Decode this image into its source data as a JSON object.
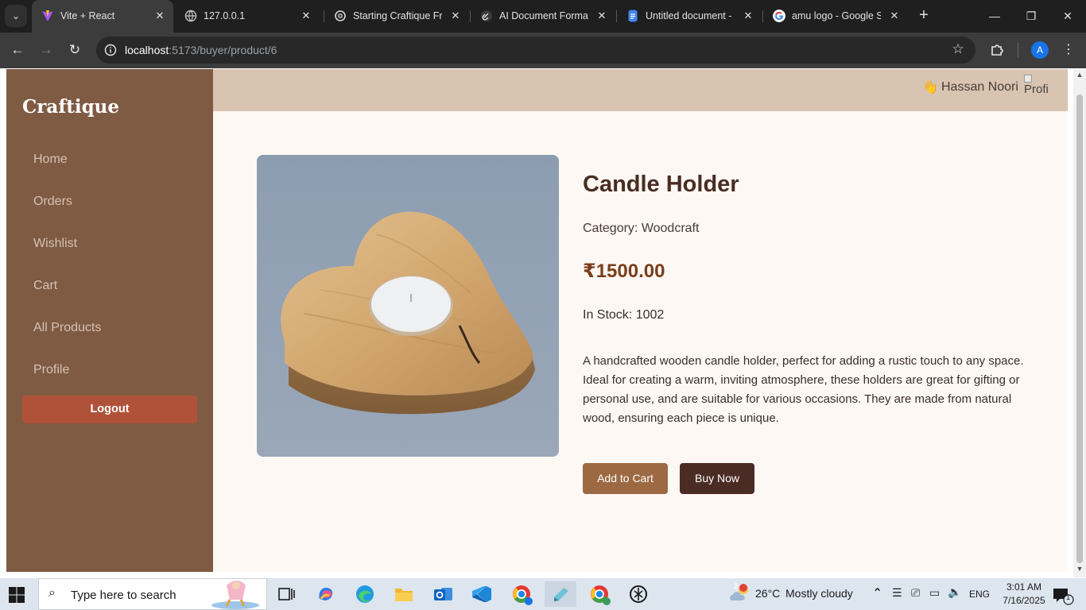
{
  "browser": {
    "tabs": [
      {
        "title": "Vite + React",
        "active": true,
        "icon": "vite-icon"
      },
      {
        "title": "127.0.0.1",
        "active": false,
        "icon": "globe-icon"
      },
      {
        "title": "Starting Craftique Fre",
        "active": false,
        "icon": "chatgpt-icon"
      },
      {
        "title": "AI Document Formatt",
        "active": false,
        "icon": "link-icon"
      },
      {
        "title": "Untitled document - ",
        "active": false,
        "icon": "docs-icon"
      },
      {
        "title": "amu logo - Google Se",
        "active": false,
        "icon": "google-icon"
      }
    ],
    "address": {
      "host": "localhost",
      "path": ":5173/buyer/product/6"
    },
    "profile_initial": "A"
  },
  "sidebar": {
    "brand": "Craftique",
    "items": [
      {
        "label": "Home"
      },
      {
        "label": "Orders"
      },
      {
        "label": "Wishlist"
      },
      {
        "label": "Cart"
      },
      {
        "label": "All Products"
      },
      {
        "label": "Profile"
      }
    ],
    "logout_label": "Logout"
  },
  "topbar": {
    "wave_emoji": "👋",
    "username": "Hassan Noori",
    "profile_alt": "Profi"
  },
  "product": {
    "title": "Candle Holder",
    "category": "Category: Woodcraft",
    "price": "₹1500.00",
    "stock": "In Stock: 1002",
    "description": "A handcrafted wooden candle holder, perfect for adding a rustic touch to any space. Ideal for creating a warm, inviting atmosphere, these holders are great for gifting or personal use, and are suitable for various occasions. They are made from natural wood, ensuring each piece is unique.",
    "add_to_cart_label": "Add to Cart",
    "buy_now_label": "Buy Now"
  },
  "taskbar": {
    "search_placeholder": "Type here to search",
    "weather": {
      "temp": "26°C",
      "condition": "Mostly cloudy",
      "badge": "2"
    },
    "language": "ENG",
    "time": "3:01 AM",
    "date": "7/16/2025",
    "notification_count": "1"
  },
  "colors": {
    "sidebar": "#7f5b43",
    "topbar": "#d9c4b1",
    "page_bg": "#fdf8f4",
    "logout": "#b0523a",
    "add_to_cart": "#9c6942",
    "buy_now": "#4a2c25",
    "price": "#7a3d1a"
  }
}
